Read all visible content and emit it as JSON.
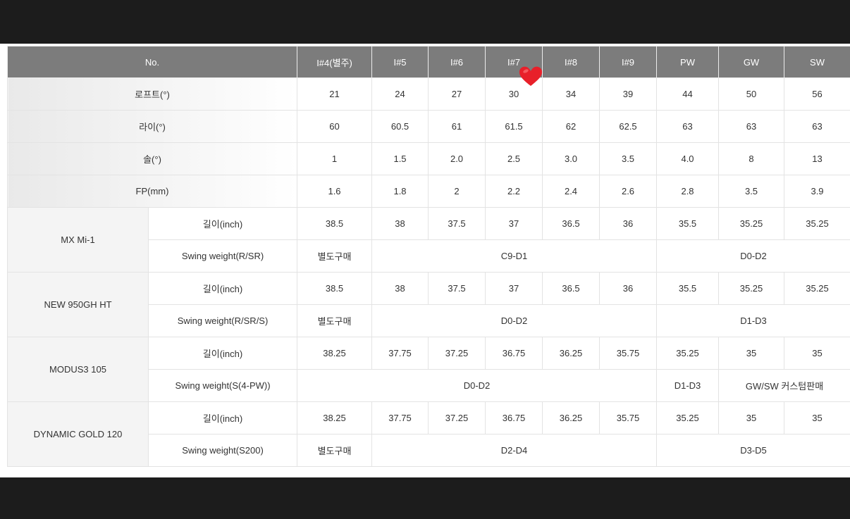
{
  "header": {
    "no": "No.",
    "cols": [
      "I#4(별주)",
      "I#5",
      "I#6",
      "I#7",
      "I#8",
      "I#9",
      "PW",
      "GW",
      "SW"
    ]
  },
  "spec_rows": [
    {
      "label": "로프트(°)",
      "values": [
        "21",
        "24",
        "27",
        "30",
        "34",
        "39",
        "44",
        "50",
        "56"
      ]
    },
    {
      "label": "라이(°)",
      "values": [
        "60",
        "60.5",
        "61",
        "61.5",
        "62",
        "62.5",
        "63",
        "63",
        "63"
      ]
    },
    {
      "label": "솔(°)",
      "values": [
        "1",
        "1.5",
        "2.0",
        "2.5",
        "3.0",
        "3.5",
        "4.0",
        "8",
        "13"
      ]
    },
    {
      "label": "FP(mm)",
      "values": [
        "1.6",
        "1.8",
        "2",
        "2.2",
        "2.4",
        "2.6",
        "2.8",
        "3.5",
        "3.9"
      ]
    }
  ],
  "shafts": [
    {
      "name": "MX Mi-1",
      "length_label": "길이(inch)",
      "lengths": [
        "38.5",
        "38",
        "37.5",
        "37",
        "36.5",
        "36",
        "35.5",
        "35.25",
        "35.25"
      ],
      "sw_label": "Swing weight(R/SR)",
      "sw_cells": [
        "별도구매",
        "C9-D1",
        "D0-D2"
      ]
    },
    {
      "name": "NEW 950GH HT",
      "length_label": "길이(inch)",
      "lengths": [
        "38.5",
        "38",
        "37.5",
        "37",
        "36.5",
        "36",
        "35.5",
        "35.25",
        "35.25"
      ],
      "sw_label": "Swing weight(R/SR/S)",
      "sw_cells": [
        "별도구매",
        "D0-D2",
        "D1-D3"
      ]
    },
    {
      "name": "MODUS3 105",
      "length_label": "길이(inch)",
      "lengths": [
        "38.25",
        "37.75",
        "37.25",
        "36.75",
        "36.25",
        "35.75",
        "35.25",
        "35",
        "35"
      ],
      "sw_label": "Swing weight(S(4-PW))",
      "sw_cells": [
        "D0-D2",
        "D1-D3",
        "GW/SW 커스텀판매"
      ]
    },
    {
      "name": "DYNAMIC GOLD 120",
      "length_label": "길이(inch)",
      "lengths": [
        "38.25",
        "37.75",
        "37.25",
        "36.75",
        "36.25",
        "35.75",
        "35.25",
        "35",
        "35"
      ],
      "sw_label": "Swing weight(S200)",
      "sw_cells": [
        "별도구매",
        "D2-D4",
        "D3-D5"
      ]
    }
  ],
  "colors": {
    "header_bg": "#7c7c7c",
    "heart": "#e8202a"
  },
  "icons": {
    "overlay": "heart-icon"
  }
}
